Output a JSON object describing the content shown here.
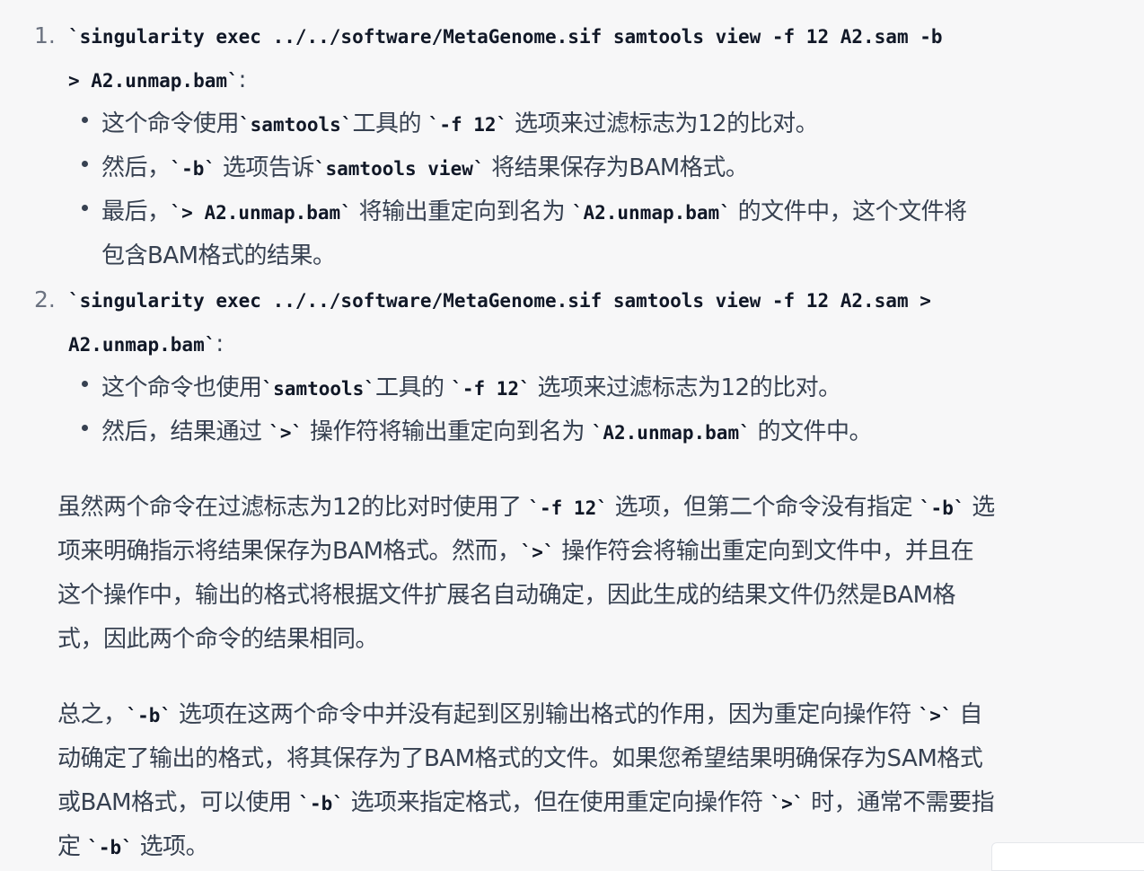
{
  "item1": {
    "number": "1.",
    "code": "`singularity exec ../../software/MetaGenome.sif samtools view -f 12 A2.sam -b",
    "code_cont": "> A2.unmap.bam`",
    "colon": ":",
    "bullets": [
      {
        "a": "这个命令使用",
        "b": "`samtools`",
        "c": "工具的 ",
        "d": "`-f 12`",
        "e": " 选项来过滤标志为12的比对。"
      },
      {
        "a": "然后，",
        "b": "`-b`",
        "c": " 选项告诉",
        "d": "`samtools view`",
        "e": " 将结果保存为BAM格式。"
      },
      {
        "a": "最后，",
        "b": "`> A2.unmap.bam`",
        "c": " 将输出重定向到名为 ",
        "d": "`A2.unmap.bam`",
        "e": " 的文件中，这个文件将",
        "f": "包含BAM格式的结果。"
      }
    ]
  },
  "item2": {
    "number": "2.",
    "code": "`singularity exec ../../software/MetaGenome.sif samtools view -f 12 A2.sam >",
    "code_cont": "A2.unmap.bam`",
    "colon": ":",
    "bullets": [
      {
        "a": "这个命令也使用",
        "b": "`samtools`",
        "c": "工具的 ",
        "d": "`-f 12`",
        "e": " 选项来过滤标志为12的比对。"
      },
      {
        "a": "然后，结果通过 ",
        "b": "`>`",
        "c": " 操作符将输出重定向到名为 ",
        "d": "`A2.unmap.bam`",
        "e": " 的文件中。"
      }
    ]
  },
  "para1": {
    "l1a": "虽然两个命令在过滤标志为12的比对时使用了 ",
    "l1b": "`-f 12`",
    "l1c": " 选项，但第二个命令没有指定 ",
    "l1d": "`-b`",
    "l1e": " 选",
    "l2a": "项来明确指示将结果保存为BAM格式。然而，",
    "l2b": "`>`",
    "l2c": " 操作符会将输出重定向到文件中，并且在",
    "l3": "这个操作中，输出的格式将根据文件扩展名自动确定，因此生成的结果文件仍然是BAM格",
    "l4": "式，因此两个命令的结果相同。"
  },
  "para2": {
    "l1a": "总之，",
    "l1b": "`-b`",
    "l1c": " 选项在这两个命令中并没有起到区别输出格式的作用，因为重定向操作符 ",
    "l1d": "`>`",
    "l1e": " 自",
    "l2": "动确定了输出的格式，将其保存为了BAM格式的文件。如果您希望结果明确保存为SAM格式",
    "l3a": "或BAM格式，可以使用 ",
    "l3b": "`-b`",
    "l3c": " 选项来指定格式，但在使用重定向操作符 ",
    "l3d": "`>`",
    "l3e": " 时，通常不需要指",
    "l4a": "定 ",
    "l4b": "`-b`",
    "l4c": " 选项。"
  },
  "colors": {
    "background": "#f7f7f8",
    "text": "#374151",
    "code": "#111827",
    "number": "#6b7280"
  }
}
